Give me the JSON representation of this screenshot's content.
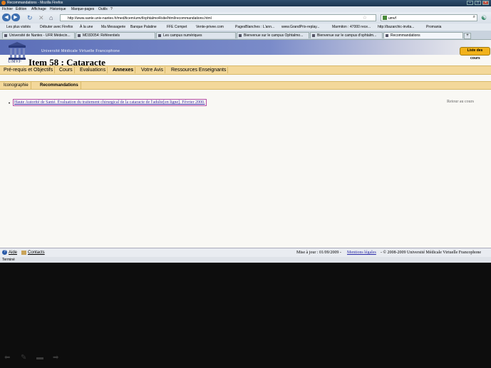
{
  "window": {
    "title": "Recommandations - Mozilla Firefox"
  },
  "menubar": {
    "items": [
      "Fichier",
      "Édition",
      "Affichage",
      "Historique",
      "Marque-pages",
      "Outils",
      "?"
    ]
  },
  "navbar": {
    "url": "http://www.sante.univ-nantes.fr/med/ticem/umvf/ophtalmo4/site/html/recommandations.html",
    "search_value": "umvf"
  },
  "bookmarks": [
    "Les plus visités",
    "Débuter avec Firefox",
    "À la une",
    "Ma Messagerie",
    "Banque Palatine",
    "FFE Compet",
    "Vente-privee.com",
    "PagesBlanches : L'ann...",
    "www.GrandPrix-replay...",
    "Marmiton : 47000 rece...",
    "http://bazarchic-invita...",
    "Promania"
  ],
  "tabs": [
    {
      "label": "Université de Nantes - UFR Médecin...",
      "active": false
    },
    {
      "label": "MD3D054: Référentiels",
      "active": false
    },
    {
      "label": "Les campus numériques",
      "active": false
    },
    {
      "label": "Bienvenue sur le campus Ophtalmo...",
      "active": false
    },
    {
      "label": "Bienvenue sur le campus d'ophtalm...",
      "active": false
    },
    {
      "label": "Recommandations",
      "active": true
    }
  ],
  "site": {
    "university": "Université Médicale Virtuelle Francophone",
    "item_title": "Item 58 : Cataracte",
    "liste_label": "Liste des",
    "cours_label": "cours"
  },
  "nav_main": [
    "Pré-requis et Objectifs",
    "Cours",
    "Evaluations",
    "Annexes",
    "Votre Avis",
    "Ressources Enseignants"
  ],
  "nav_sub": [
    "Iconographie",
    "Recommandations"
  ],
  "content": {
    "reference": "Haute Autorité de Santé. Évaluation du traitement chirurgical de la cataracte de l'adulte[en ligne]. Février 2000.",
    "retour": "Retour au cours"
  },
  "footer": {
    "aide": "Aide",
    "contacts": "Contacts",
    "maj": "Mise à jour : 01/09/2009 -",
    "mentions": "Mentions légales",
    "copyright": "- © 2008-2009 Université Médicale Virtuelle Francophone"
  },
  "status": {
    "text": "Terminé"
  }
}
